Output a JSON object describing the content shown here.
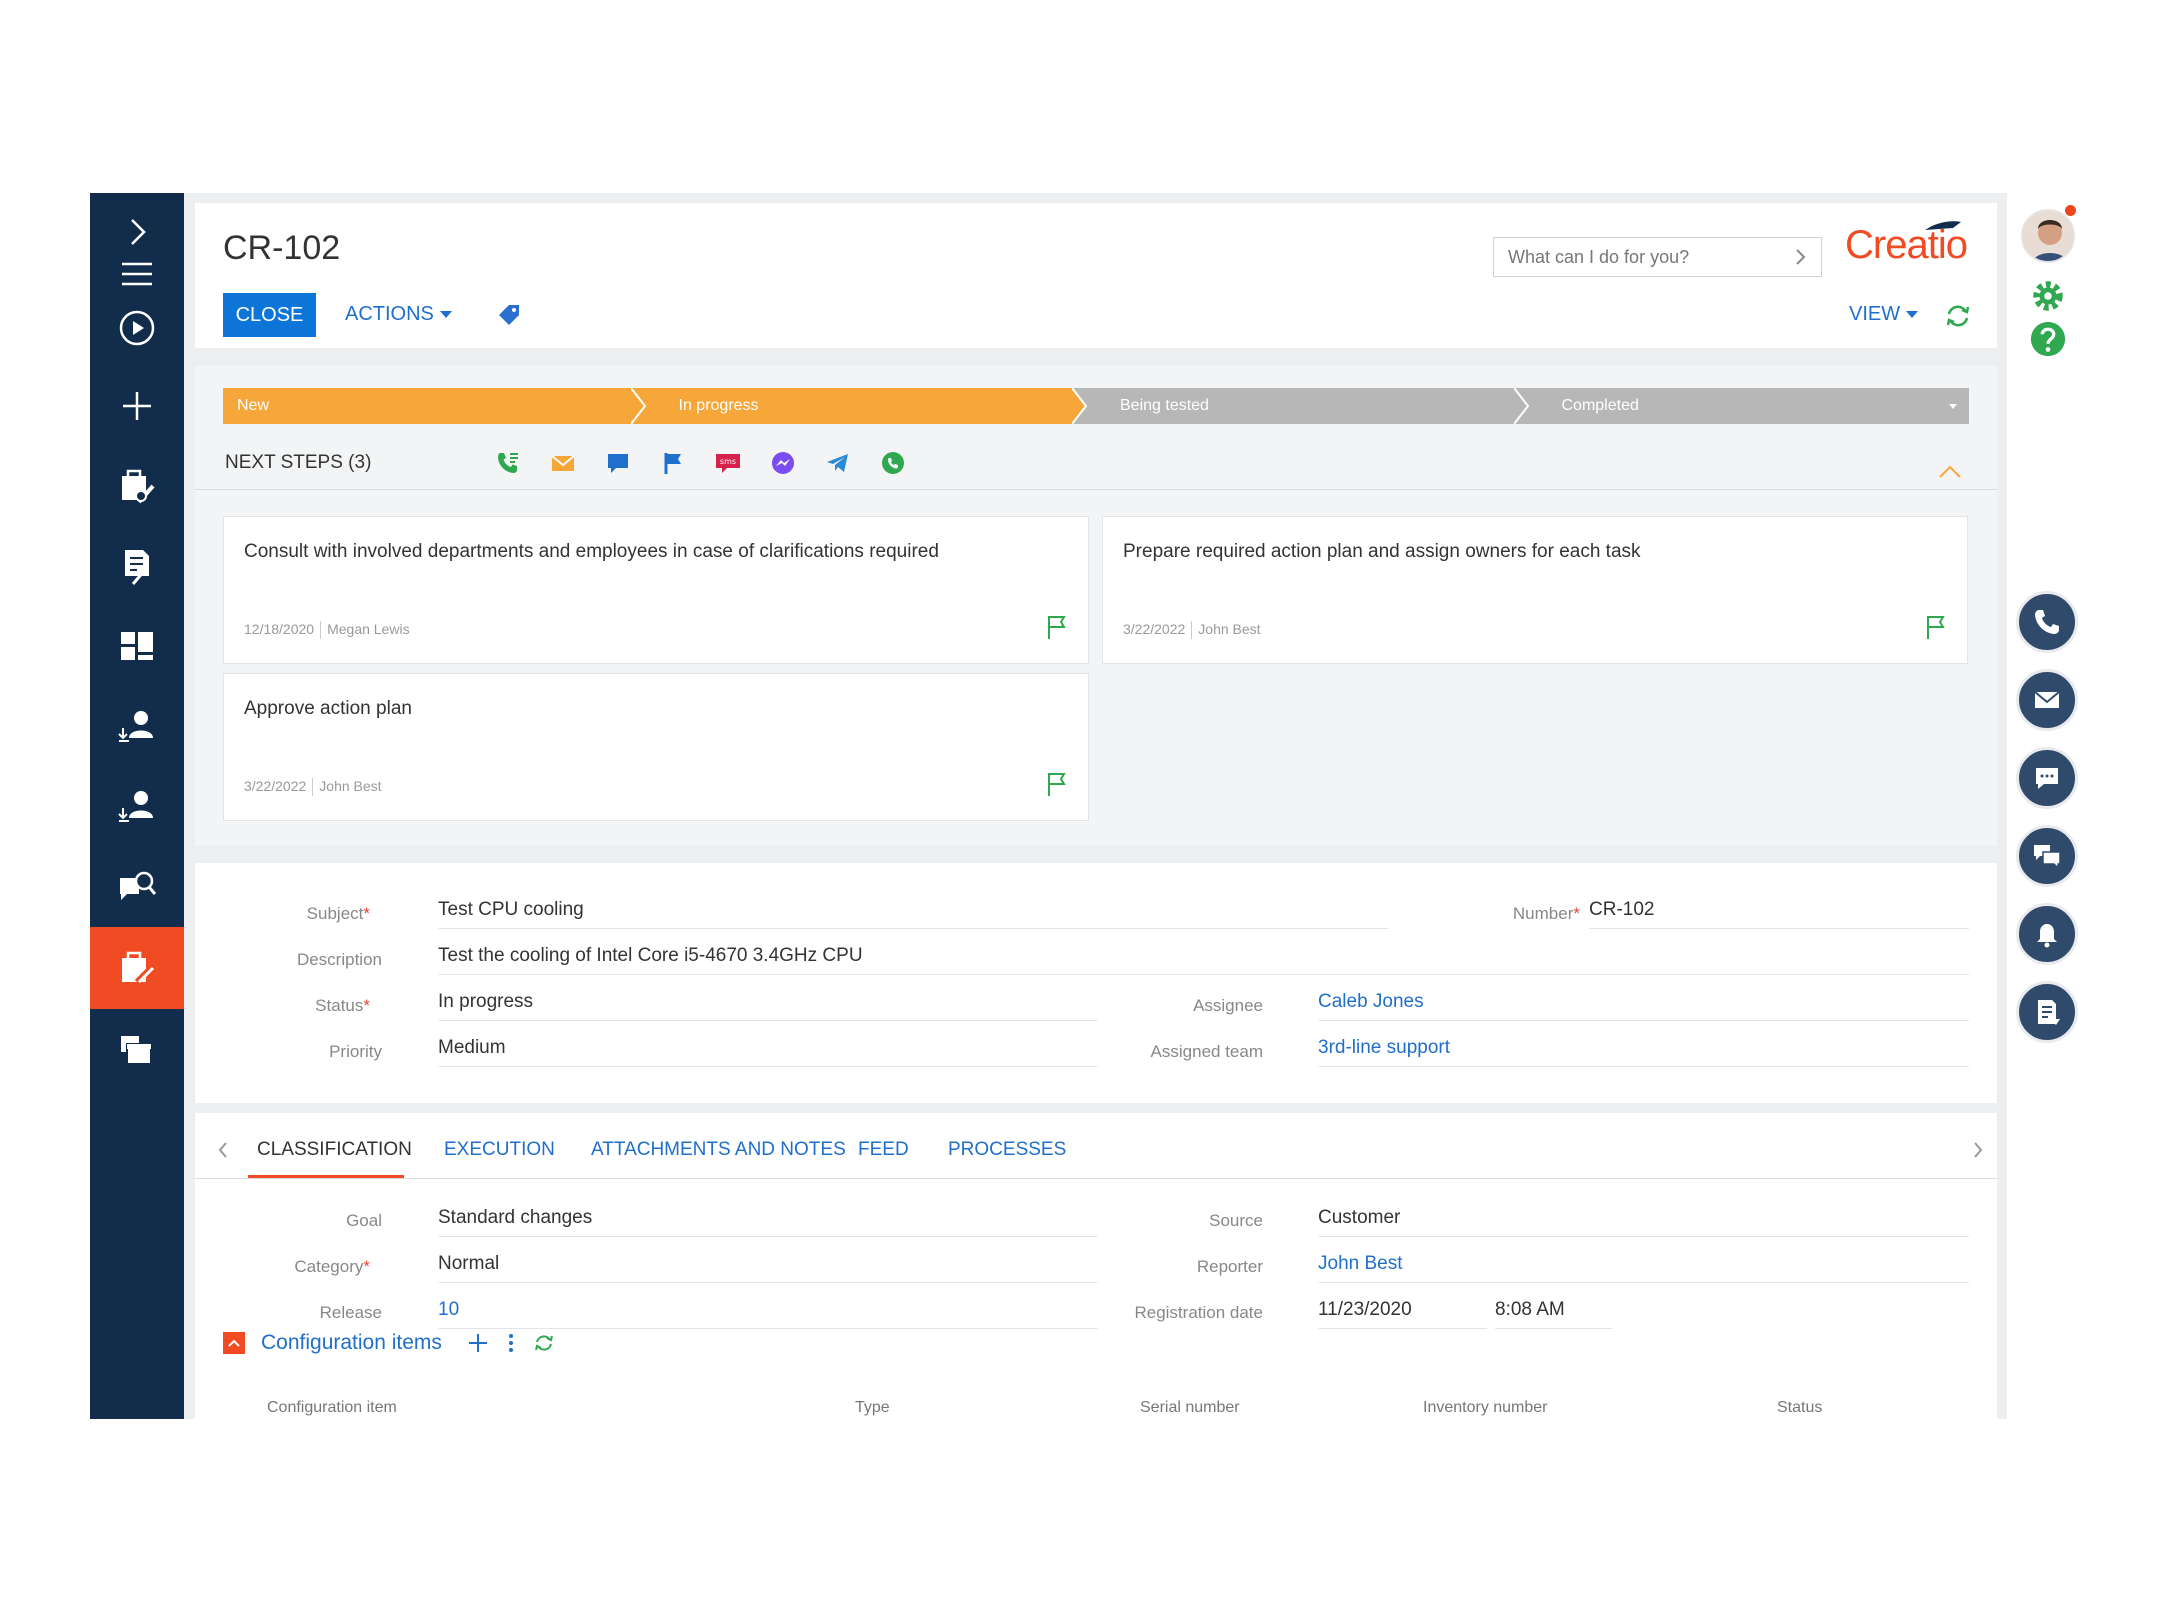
{
  "header": {
    "title": "CR-102",
    "close_label": "CLOSE",
    "actions_label": "ACTIONS",
    "search_placeholder": "What can I do for you?",
    "logo_text": "Creatio",
    "view_label": "VIEW"
  },
  "sidebar": {
    "items": [
      "expand-icon",
      "menu-icon",
      "play-icon",
      "add-icon",
      "cases-icon",
      "documents-icon",
      "dashboards-icon",
      "contacts-import-icon",
      "accounts-import-icon",
      "knowledge-search-icon",
      "changes-icon",
      "releases-icon"
    ],
    "active_index": 10
  },
  "stages": [
    "New",
    "In progress",
    "Being tested",
    "Completed"
  ],
  "stage_colors": {
    "active": "#f7a739",
    "inactive": "#b7b7b7"
  },
  "next_steps": {
    "label": "NEXT STEPS (3)",
    "channel_icons": [
      "call-icon",
      "email-icon",
      "chat-icon",
      "flag-icon",
      "sms-icon",
      "messenger-icon",
      "telegram-icon",
      "whatsapp-icon"
    ],
    "cards": [
      {
        "text": "Consult with involved departments and employees in case of clarifications required",
        "date": "12/18/2020",
        "owner": "Megan Lewis"
      },
      {
        "text": "Prepare required action plan and assign owners for each task",
        "date": "3/22/2022",
        "owner": "John Best"
      },
      {
        "text": "Approve action plan",
        "date": "3/22/2022",
        "owner": "John Best"
      }
    ]
  },
  "fields": {
    "subject_label": "Subject",
    "subject": "Test CPU cooling",
    "number_label": "Number",
    "number": "CR-102",
    "description_label": "Description",
    "description": "Test the cooling of Intel Core i5-4670 3.4GHz CPU",
    "status_label": "Status",
    "status": "In progress",
    "assignee_label": "Assignee",
    "assignee": "Caleb Jones",
    "priority_label": "Priority",
    "priority": "Medium",
    "team_label": "Assigned team",
    "team": "3rd-line support",
    "required_mark": "*"
  },
  "tabs": [
    "CLASSIFICATION",
    "EXECUTION",
    "ATTACHMENTS AND NOTES",
    "FEED",
    "PROCESSES"
  ],
  "classification": {
    "goal_label": "Goal",
    "goal": "Standard changes",
    "source_label": "Source",
    "source": "Customer",
    "category_label": "Category",
    "category": "Normal",
    "reporter_label": "Reporter",
    "reporter": "John Best",
    "release_label": "Release",
    "release": "10",
    "reg_date_label": "Registration date",
    "reg_date": "11/23/2020",
    "reg_time": "8:08 AM"
  },
  "config_items": {
    "title": "Configuration items",
    "columns": [
      "Configuration item",
      "Type",
      "Serial number",
      "Inventory number",
      "Status"
    ]
  },
  "colors": {
    "sidebar": "#122d4b",
    "accent": "#f04b23",
    "primary": "#0e75d8",
    "link": "#1f6fcc"
  }
}
